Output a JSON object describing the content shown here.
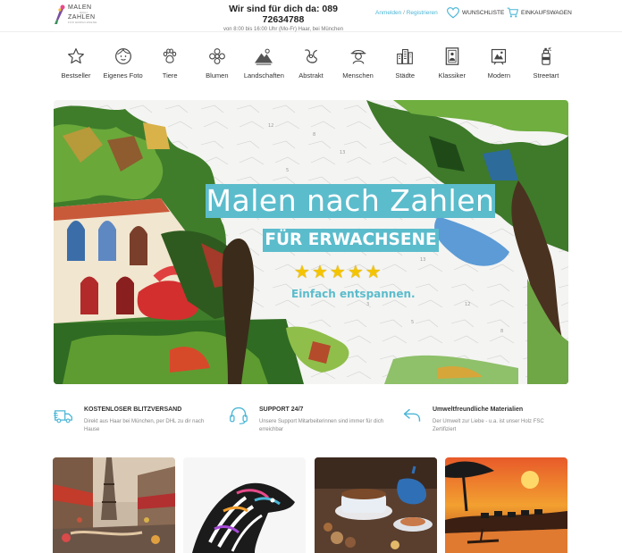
{
  "header": {
    "logo": {
      "line1": "MALEN",
      "line2": "NACH",
      "line3": "ZAHLEN",
      "line4": "FÜR ERWACHSENE"
    },
    "hotline_title": "Wir sind für dich da: 089 72634788",
    "hotline_hours": "von 8:00 bis 16:00 Uhr (Mo-Fr) Haar, bei München",
    "login": "Anmelden",
    "separator": "/",
    "register": "Registrieren",
    "wishlist": "WUNSCHLISTE",
    "cart": "EINKAUFSWAGEN"
  },
  "categories": [
    {
      "label": "Bestseller",
      "icon": "star-icon"
    },
    {
      "label": "Eigenes Foto",
      "icon": "face-icon"
    },
    {
      "label": "Tiere",
      "icon": "paw-icon"
    },
    {
      "label": "Blumen",
      "icon": "flower-icon"
    },
    {
      "label": "Landschaften",
      "icon": "mountain-icon"
    },
    {
      "label": "Abstrakt",
      "icon": "abstract-icon"
    },
    {
      "label": "Menschen",
      "icon": "person-icon"
    },
    {
      "label": "Städte",
      "icon": "city-icon"
    },
    {
      "label": "Klassiker",
      "icon": "classic-frame-icon"
    },
    {
      "label": "Modern",
      "icon": "modern-frame-icon"
    },
    {
      "label": "Streetart",
      "icon": "spray-can-icon"
    }
  ],
  "hero": {
    "title": "Malen nach Zahlen",
    "subtitle": "FÜR ERWACHSENE",
    "stars": "★★★★★",
    "claim": "Einfach entspannen."
  },
  "features": [
    {
      "title": "KOSTENLOSER BLITZVERSAND",
      "desc": "Direkt aus Haar bei München, per DHL zu dir nach Hause",
      "icon": "truck-icon"
    },
    {
      "title": "SUPPORT 24/7",
      "desc": "Unsere Support Mitarbeiterinnen sind immer für dich erreichbar",
      "icon": "headset-icon"
    },
    {
      "title": "Umweltfreundliche Materialien",
      "desc": "Der Umwelt zur Liebe - u.a. ist unser Holz FSC Zertifiziert",
      "icon": "return-arrow-icon"
    }
  ],
  "products": [
    {
      "name": "paris-painting"
    },
    {
      "name": "zebra-painting"
    },
    {
      "name": "coffee-painting"
    },
    {
      "name": "savanna-painting"
    }
  ],
  "colors": {
    "accent": "#5bbccc",
    "link": "#4ab6d6",
    "star": "#f5c400"
  }
}
